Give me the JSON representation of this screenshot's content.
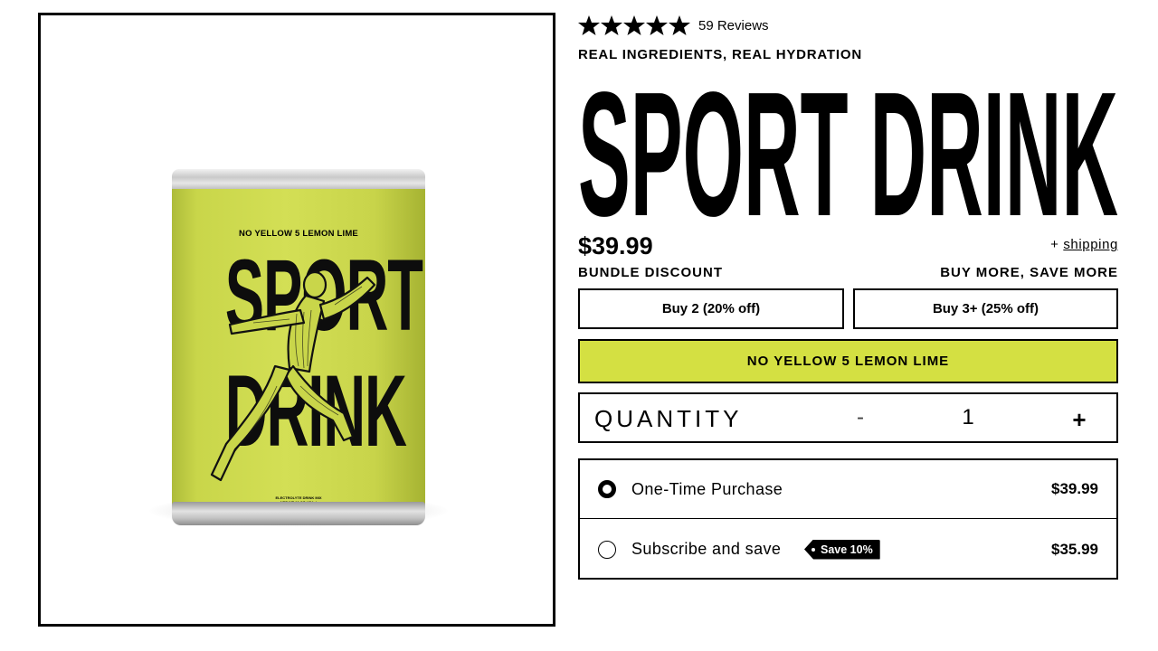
{
  "product_image": {
    "can_flavor": "NO YELLOW 5 LEMON LIME",
    "can_word_1": "SPORT",
    "can_word_2": "DRINK",
    "can_small_line_1": "ELECTROLYTE DRINK MIX",
    "can_small_line_2": "NET WT 16 OZ (454g)"
  },
  "rating": {
    "stars": 5,
    "reviews_label": "59 Reviews"
  },
  "tagline": "REAL INGREDIENTS, REAL HYDRATION",
  "title": "SPORT DRINK",
  "price": "$39.99",
  "shipping": {
    "prefix": "+ ",
    "link": "shipping"
  },
  "bundle": {
    "label": "BUNDLE DISCOUNT",
    "promo": "BUY MORE, SAVE MORE",
    "options": [
      "Buy 2 (20% off)",
      "Buy 3+ (25% off)"
    ]
  },
  "flavor": {
    "selected": "NO YELLOW 5 LEMON LIME",
    "color": "#d4e042"
  },
  "quantity": {
    "label": "QUANTITY",
    "minus": "-",
    "value": "1",
    "plus": "+"
  },
  "purchase_options": [
    {
      "label": "One-Time Purchase",
      "price": "$39.99",
      "selected": true
    },
    {
      "label": "Subscribe and save",
      "badge": "Save 10%",
      "price": "$35.99",
      "selected": false
    }
  ]
}
